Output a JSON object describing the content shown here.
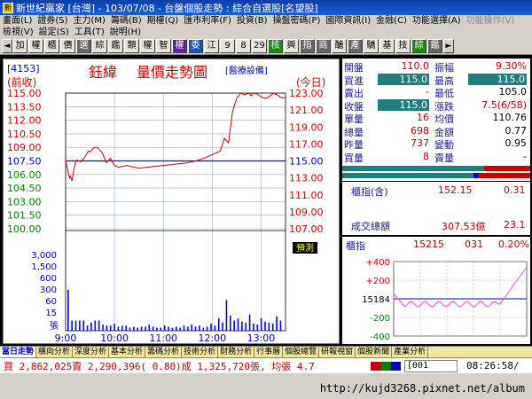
{
  "titlebar": {
    "icon_glyph": "新",
    "title": "新世紀贏家 [台灣] - 103/07/08 - 台盤個股走勢 : 綜合自選股[名望股]"
  },
  "menu1": [
    {
      "label": "畫面(L)",
      "enabled": true
    },
    {
      "label": "證券(S)",
      "enabled": true
    },
    {
      "label": "主力(M)",
      "enabled": true
    },
    {
      "label": "籌碼(B)",
      "enabled": true
    },
    {
      "label": "期權(Q)",
      "enabled": true
    },
    {
      "label": "匯市利率(F)",
      "enabled": true
    },
    {
      "label": "投資(B)",
      "enabled": true
    },
    {
      "label": "操盤密碼(P)",
      "enabled": true
    },
    {
      "label": "國際資訊(I)",
      "enabled": true
    },
    {
      "label": "金融(C)",
      "enabled": true
    },
    {
      "label": "功能選擇(A)",
      "enabled": true
    },
    {
      "label": "功能操作(V)",
      "enabled": false
    }
  ],
  "menu2": [
    {
      "label": "檢視(V)",
      "enabled": true
    },
    {
      "label": "設定(S)",
      "enabled": true
    },
    {
      "label": "工具(T)",
      "enabled": true
    },
    {
      "label": "說明(H)",
      "enabled": true
    }
  ],
  "toolbar": [
    "加",
    "權",
    "櫃",
    "價",
    "選",
    "綜",
    "鑑",
    "類",
    "權",
    "智",
    "權",
    "委",
    "江",
    "9",
    "8",
    "29",
    "核",
    "興",
    "指",
    "商",
    "醣",
    "產",
    "驕",
    "基",
    "技",
    "綜",
    "鑑"
  ],
  "stock": {
    "code": "[4153]",
    "name": "鈺緯",
    "chart_title": "量價走勢圖",
    "category": "[醫療設備]",
    "left_axis_title": "(前收)",
    "right_axis_title": "(今日)",
    "volume_tag": "預測"
  },
  "chart_data": {
    "type": "line",
    "x_ticks": [
      "9:00",
      "10:00",
      "11:00",
      "12:00",
      "13:00"
    ],
    "left_ticks": [
      "115.00",
      "113.50",
      "112.00",
      "110.50",
      "109.00",
      "107.50",
      "106.00",
      "104.50",
      "103.00",
      "101.50",
      "100.00"
    ],
    "right_ticks": [
      "123.00",
      "121.00",
      "119.00",
      "117.00",
      "115.00",
      "113.00",
      "111.00",
      "109.00",
      "107.00"
    ],
    "volume_ticks": [
      "3,000",
      "1,500",
      "600",
      "300",
      "60",
      "15"
    ],
    "volume_unit": "張",
    "reference_price": 107.5,
    "price_range": [
      100.0,
      115.0
    ],
    "series": [
      {
        "values_time": [
          0,
          3,
          5,
          6,
          8,
          9,
          10,
          12,
          14,
          16,
          18,
          20,
          22,
          24,
          26,
          28,
          30,
          33,
          36,
          40,
          45,
          50,
          55,
          60,
          65,
          70,
          75,
          80,
          90,
          100,
          110,
          120,
          130,
          140,
          150,
          160,
          170,
          180,
          190,
          195,
          200,
          205,
          210,
          215,
          220,
          225,
          228,
          230,
          235,
          240,
          245,
          250,
          255,
          260,
          265,
          270
        ],
        "values": [
          107.5,
          106.3,
          105.6,
          105.8,
          105.3,
          106.0,
          106.5,
          107.3,
          107.6,
          107.5,
          107.4,
          107.6,
          107.7,
          108.0,
          108.3,
          108.6,
          108.5,
          108.8,
          109.0,
          108.9,
          108.4,
          107.3,
          107.8,
          107.0,
          106.8,
          106.9,
          107.0,
          106.9,
          106.7,
          106.8,
          106.9,
          107.0,
          107.1,
          107.2,
          107.3,
          107.5,
          107.8,
          108.2,
          108.6,
          110.0,
          109.5,
          113.0,
          114.4,
          115.0,
          114.8,
          115.0,
          114.7,
          115.0,
          114.9,
          114.6,
          114.4,
          114.6,
          115.0,
          114.8,
          114.5,
          114.5
        ]
      }
    ],
    "volume": [
      4,
      1,
      1,
      1,
      1,
      0.5,
      0.8,
      1,
      1,
      0.6,
      0.5,
      0.5,
      0.7,
      0.4,
      0.5,
      0.5,
      0.3,
      0.4,
      0.3,
      0.4,
      0.4,
      0.6,
      0.4,
      0.3,
      0.3,
      0.5,
      0.4,
      0.3,
      0.4,
      0.3,
      0.5,
      0.4,
      0.6,
      0.4,
      0.5,
      0.3,
      0.4,
      0.7,
      0.5,
      1.2,
      0.8,
      3,
      1.5,
      1,
      1.2,
      0.9,
      0.8,
      1.6,
      0.7,
      0.6,
      1.2,
      0.9,
      0.8,
      0.7,
      1.4,
      1.0
    ],
    "time_range": [
      0,
      270
    ]
  },
  "quote": {
    "rows": [
      {
        "l1": "開盤",
        "v1": "110.0",
        "l2": "振幅",
        "v2": "9.30%",
        "v2color": "#c00000"
      },
      {
        "l1": "買進",
        "v1": "115.0",
        "l2": "最高",
        "v2": "115.0",
        "hl1": true,
        "hl2": true
      },
      {
        "l1": "賣出",
        "v1": "-",
        "l2": "最低",
        "v2": "105.0"
      },
      {
        "l1": "收盤",
        "v1": "115.0",
        "l2": "漲跌",
        "v2": "7.5(6/58)",
        "hl1": true,
        "v2color": "#c00000"
      },
      {
        "l1": "單量",
        "v1": "16",
        "l2": "均價",
        "v2": "110.76"
      },
      {
        "l1": "總量",
        "v1": "698",
        "l2": "金額",
        "v2": "0.77"
      },
      {
        "l1": "昨量",
        "v1": "737",
        "l2": "變動",
        "v2": "0.95"
      },
      {
        "l1": "買量",
        "v1": "8",
        "l2": "賣量",
        "v2": "-"
      }
    ]
  },
  "index": {
    "label": "櫃指(含)",
    "value": "152.15",
    "change": "0.31",
    "turnover_label": "成交總額",
    "turnover": "307.53億",
    "turnover_change": "23.1"
  },
  "mini": {
    "title": "櫃指",
    "value": "15215",
    "change": "031",
    "pct": "0.20%",
    "ticks": [
      "+400",
      "+200",
      "15184",
      "-200",
      "-400"
    ]
  },
  "tabs": [
    "當日走勢",
    "橫向分析",
    "深度分析",
    "基本分析",
    "籌碼分析",
    "技術分析",
    "財務分析",
    "行事曆",
    "個股總覽",
    "研報視窗",
    "個股新聞",
    "產業分析"
  ],
  "status": {
    "ticker": "買 2,862,025賣 2,290,396( 0.80)成 1,325,720張, 均張 4.7",
    "input": "[001",
    "clock": "08:26:58/"
  },
  "watermark": "http://kujd3268.pixnet.net/album",
  "colors": {
    "price_line": "#d00000",
    "avg_line": "#0000ff",
    "volume": "#0000ff",
    "reference": "#0000ff",
    "axis_up": "#d00000"
  }
}
